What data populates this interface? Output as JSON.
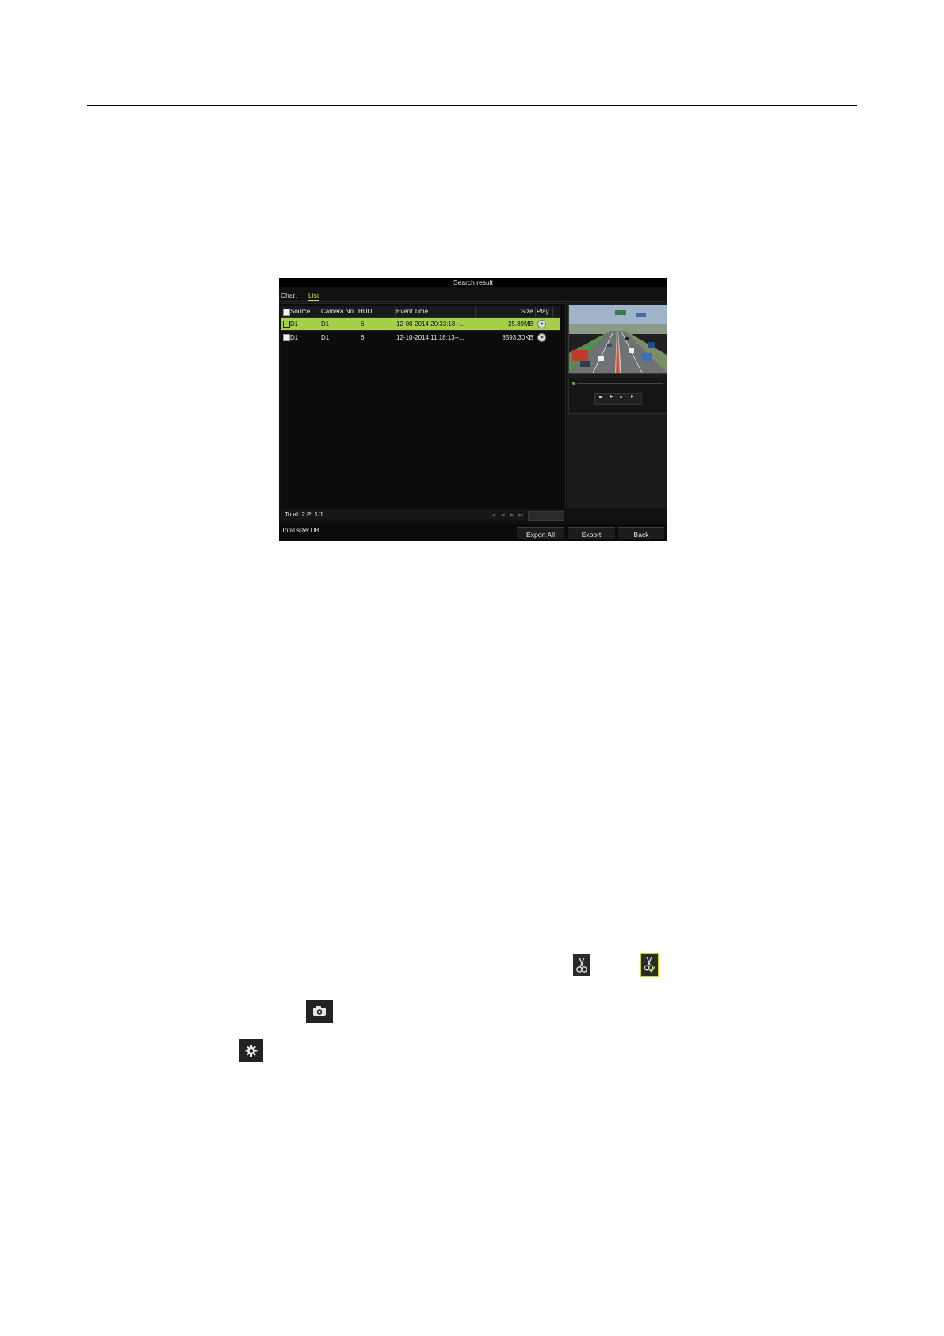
{
  "window": {
    "title": "Search result"
  },
  "tabs": [
    {
      "label": "Chart"
    },
    {
      "label": "List"
    }
  ],
  "table": {
    "headers": {
      "source": "Source",
      "camera": "Camera No.",
      "hdd": "HDD",
      "event_time": "Event Time",
      "size": "Size",
      "play": "Play"
    },
    "rows": [
      {
        "source": "D1",
        "camera": "D1",
        "hdd": "6",
        "event_time": "12-08-2014 20:33:18--...",
        "size": "25.89MB",
        "selected": true
      },
      {
        "source": "D1",
        "camera": "D1",
        "hdd": "6",
        "event_time": "12-10-2014 11:18:13--...",
        "size": "8593.30KB",
        "selected": false
      }
    ]
  },
  "status": {
    "total": "Total: 2  P: 1/1",
    "total_size": "Total size: 0B"
  },
  "buttons": {
    "export_all": "Export All",
    "export": "Export",
    "back": "Back"
  },
  "icons": {
    "clip": "scissors-icon",
    "clip_done": "scissors-check-icon",
    "snapshot": "camera-icon",
    "settings": "gear-icon"
  },
  "colors": {
    "selection": "#a6d04a",
    "accent_tab": "#c8e04a",
    "window_bg": "#111111"
  }
}
